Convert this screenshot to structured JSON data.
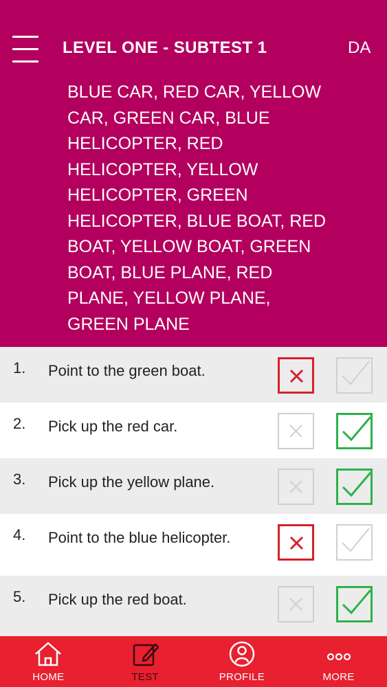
{
  "header": {
    "title": "LEVEL ONE - SUBTEST 1",
    "initials": "DA",
    "word_list": "BLUE CAR, RED CAR, YELLOW CAR, GREEN CAR, BLUE HELICOPTER, RED HELICOPTER, YELLOW HELICOPTER, GREEN HELICOPTER, BLUE BOAT, RED BOAT, YELLOW BOAT, GREEN BOAT, BLUE PLANE, RED PLANE, YELLOW PLANE, GREEN PLANE"
  },
  "items": [
    {
      "number": "1.",
      "text": "Point to the green boat.",
      "result": "incorrect"
    },
    {
      "number": "2.",
      "text": "Pick up the red car.",
      "result": "correct"
    },
    {
      "number": "3.",
      "text": "Pick up the yellow plane.",
      "result": "correct"
    },
    {
      "number": "4.",
      "text": "Point to the blue helicopter.",
      "result": "incorrect"
    },
    {
      "number": "5.",
      "text": "Pick up the red boat.",
      "result": "correct"
    }
  ],
  "tabs": {
    "home": "HOME",
    "test": "TEST",
    "profile": "PROFILE",
    "more": "MORE"
  },
  "colors": {
    "header_bg": "#b3005e",
    "tabbar_bg": "#e8202f",
    "incorrect": "#d6202c",
    "correct": "#2eb14a",
    "inactive": "#cfcfcf"
  }
}
